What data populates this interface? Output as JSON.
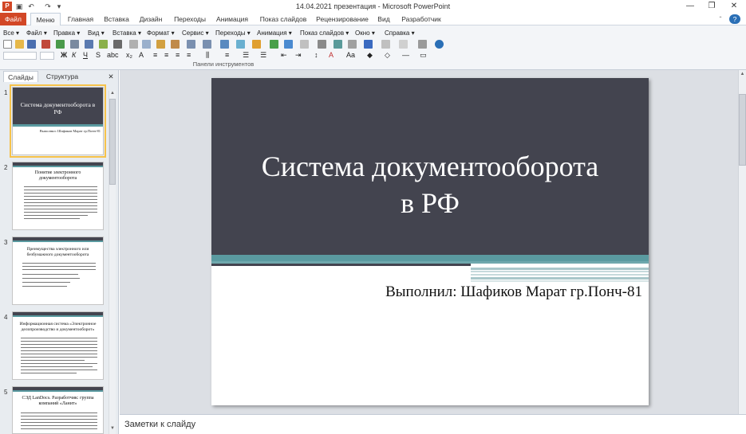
{
  "window": {
    "title": "14.04.2021 презентация - Microsoft PowerPoint"
  },
  "tabs": [
    "Файл",
    "Меню",
    "Главная",
    "Вставка",
    "Дизайн",
    "Переходы",
    "Анимация",
    "Показ слайдов",
    "Рецензирование",
    "Вид",
    "Разработчик"
  ],
  "menus": [
    "Все ▾",
    "Файл ▾",
    "Правка ▾",
    "Вид ▾",
    "Вставка ▾",
    "Формат ▾",
    "Сервис ▾",
    "Переходы ▾",
    "Анимация ▾",
    "Показ слайдов ▾",
    "Окно ▾",
    "Справка ▾"
  ],
  "ribbon": {
    "group_label": "Панели инструментов"
  },
  "panel": {
    "tab_slides": "Слайды",
    "tab_outline": "Структура",
    "close": "✕"
  },
  "thumbnails": [
    {
      "num": "1",
      "title": "Система документооборота в РФ",
      "sub": "Выполнил: Шафиков Марат гр.Понч-81"
    },
    {
      "num": "2",
      "title": "Понятие электронного документооборота"
    },
    {
      "num": "3",
      "title": "Преимущества электронного или безбумажного документооборота"
    },
    {
      "num": "4",
      "title": "Информационная система «Электронное делопроизводство и документооборот»"
    },
    {
      "num": "5",
      "title": "СЭД LanDocs. Разработчик: группа компаний «Ланит»"
    }
  ],
  "slide": {
    "title_line1": "Система документооборота",
    "title_line2": "в РФ",
    "subtitle": "Выполнил: Шафиков Марат гр.Понч-81"
  },
  "notes": {
    "placeholder": "Заметки к слайду"
  },
  "colors": {
    "file_tab": "#d24726",
    "slide_dark": "#43444f",
    "slide_accent": "#5a9aa0"
  }
}
